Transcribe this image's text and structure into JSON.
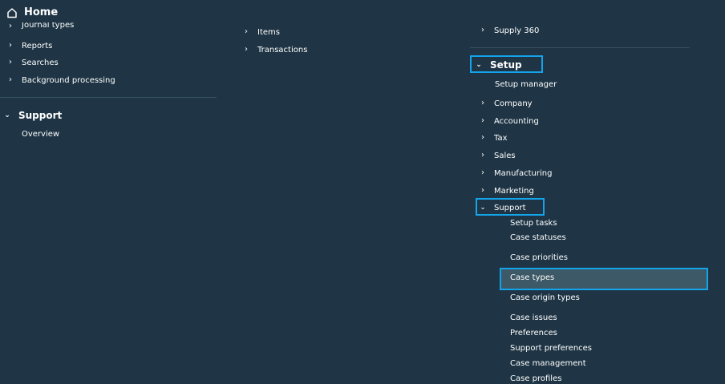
{
  "header": {
    "title": "Home",
    "icon": "home-icon"
  },
  "col1": {
    "items": [
      {
        "label": "Journal types"
      },
      {
        "label": "Reports"
      },
      {
        "label": "Searches"
      },
      {
        "label": "Background processing"
      }
    ],
    "support": {
      "title": "Support",
      "items": [
        {
          "label": "Overview"
        }
      ]
    }
  },
  "col2": {
    "items": [
      {
        "label": "Items"
      },
      {
        "label": "Transactions"
      }
    ]
  },
  "col3": {
    "top_item": {
      "label": "Supply 360"
    },
    "setup": {
      "title": "Setup",
      "manager": "Setup manager",
      "items": [
        {
          "label": "Company"
        },
        {
          "label": "Accounting"
        },
        {
          "label": "Tax"
        },
        {
          "label": "Sales"
        },
        {
          "label": "Manufacturing"
        },
        {
          "label": "Marketing"
        }
      ],
      "support": {
        "title": "Support",
        "items": [
          {
            "label": "Setup tasks"
          },
          {
            "label": "Case statuses"
          },
          {
            "label": "Case priorities"
          },
          {
            "label": "Case types"
          },
          {
            "label": "Case origin types"
          },
          {
            "label": "Case issues"
          },
          {
            "label": "Preferences"
          },
          {
            "label": "Support preferences"
          },
          {
            "label": "Case management"
          },
          {
            "label": "Case profiles"
          }
        ]
      }
    }
  },
  "colors": {
    "background": "#1f3545",
    "highlight_border": "#14a4ec",
    "selected_fill": "#3d5866"
  }
}
